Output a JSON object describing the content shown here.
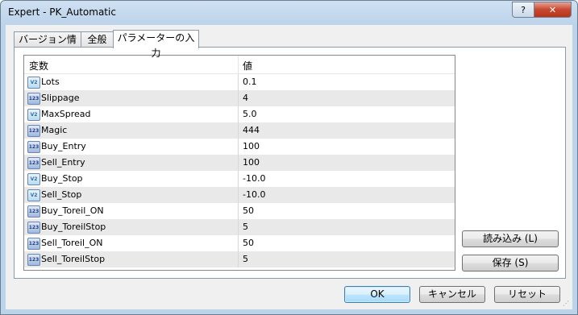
{
  "window": {
    "title": "Expert - PK_Automatic",
    "help_label": "?",
    "close_label": "✕"
  },
  "tabs": [
    {
      "label": "バージョン情報"
    },
    {
      "label": "全般"
    },
    {
      "label": "パラメーターの入力"
    }
  ],
  "grid": {
    "col_variable": "変数",
    "col_value": "値",
    "rows": [
      {
        "icon": "V2",
        "type": "real-icon",
        "name": "Lots",
        "value": "0.1"
      },
      {
        "icon": "123",
        "type": "integer-icon",
        "name": "Slippage",
        "value": "4"
      },
      {
        "icon": "V2",
        "type": "real-icon",
        "name": "MaxSpread",
        "value": "5.0"
      },
      {
        "icon": "123",
        "type": "integer-icon",
        "name": "Magic",
        "value": "444"
      },
      {
        "icon": "123",
        "type": "integer-icon",
        "name": "Buy_Entry",
        "value": "100"
      },
      {
        "icon": "123",
        "type": "integer-icon",
        "name": "Sell_Entry",
        "value": "100"
      },
      {
        "icon": "V2",
        "type": "real-icon",
        "name": "Buy_Stop",
        "value": "-10.0"
      },
      {
        "icon": "V2",
        "type": "real-icon",
        "name": "Sell_Stop",
        "value": "-10.0"
      },
      {
        "icon": "123",
        "type": "integer-icon",
        "name": "Buy_Toreil_ON",
        "value": "50"
      },
      {
        "icon": "123",
        "type": "integer-icon",
        "name": "Buy_ToreilStop",
        "value": "5"
      },
      {
        "icon": "123",
        "type": "integer-icon",
        "name": "Sell_Toreil_ON",
        "value": "50"
      },
      {
        "icon": "123",
        "type": "integer-icon",
        "name": "Sell_ToreilStop",
        "value": "5"
      }
    ]
  },
  "side_buttons": {
    "load": "読み込み (L)",
    "save": "保存 (S)"
  },
  "footer": {
    "ok": "OK",
    "cancel": "キャンセル",
    "reset": "リセット"
  }
}
